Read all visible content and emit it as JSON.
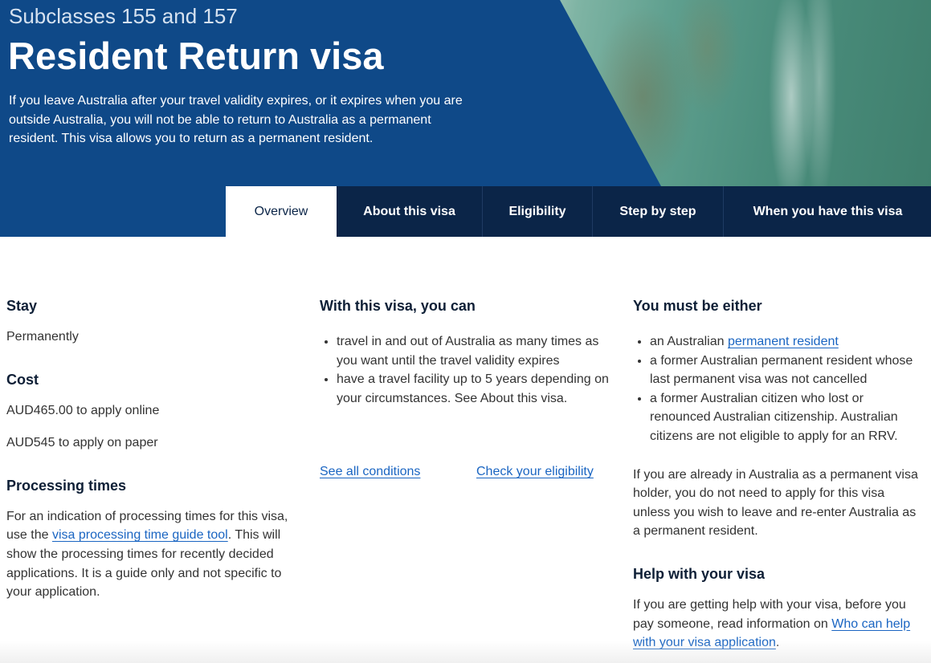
{
  "hero": {
    "subtitle": "Subclasses 155 and 157",
    "title": "Resident Return visa",
    "intro": "If you leave Australia after your travel validity expires, or it expires when you are outside Australia, you will not be able to return to Australia as a permanent resident. This visa allows you to return as a permanent resident.",
    "background_color": "#0f4988"
  },
  "tabs": [
    {
      "label": "Overview",
      "active": true
    },
    {
      "label": "About this visa",
      "active": false
    },
    {
      "label": "Eligibility",
      "active": false
    },
    {
      "label": "Step by step",
      "active": false
    },
    {
      "label": "When you have this visa",
      "active": false
    }
  ],
  "stay": {
    "heading": "Stay",
    "value": "Permanently"
  },
  "cost": {
    "heading": "Cost",
    "online": "AUD465.00 to apply online",
    "paper": "AUD545 to apply on paper"
  },
  "processing": {
    "heading": "Processing times",
    "text_before": "For an indication of processing times for this visa, use the ",
    "link": "visa processing time guide tool",
    "text_after": ". This will show the processing times for recently decided applications. It is a guide only and not specific to your application."
  },
  "with_visa": {
    "heading": "With this visa, you can",
    "items": [
      "travel in and out of Australia as many times as you want until the travel validity expires",
      "have a travel facility up to 5 years depending on your circumstances. See About this visa."
    ],
    "conditions_link": "See all conditions",
    "eligibility_link": "Check your eligibility"
  },
  "must_be": {
    "heading": "You must be either",
    "item1_before": "an Australian ",
    "item1_link": "permanent resident",
    "item2": "a former Australian permanent resident whose last permanent visa was not cancelled",
    "item3": "a former Australian citizen who lost or renounced Australian citizenship. Australian citizens are not eligible to apply for an RRV.",
    "note": "If you are already in Australia as a permanent visa holder, you do not need to apply for this visa unless you wish to leave and re-enter Australia as a permanent resident."
  },
  "help": {
    "heading": "Help with your visa",
    "text_before": "If you are getting help with your visa, before you pay someone, read information on ",
    "link": "Who can help with your visa application",
    "text_after": "."
  },
  "colors": {
    "link": "#1a65c2",
    "tab_bg": "#0b2548",
    "heading": "#0e1f36"
  }
}
